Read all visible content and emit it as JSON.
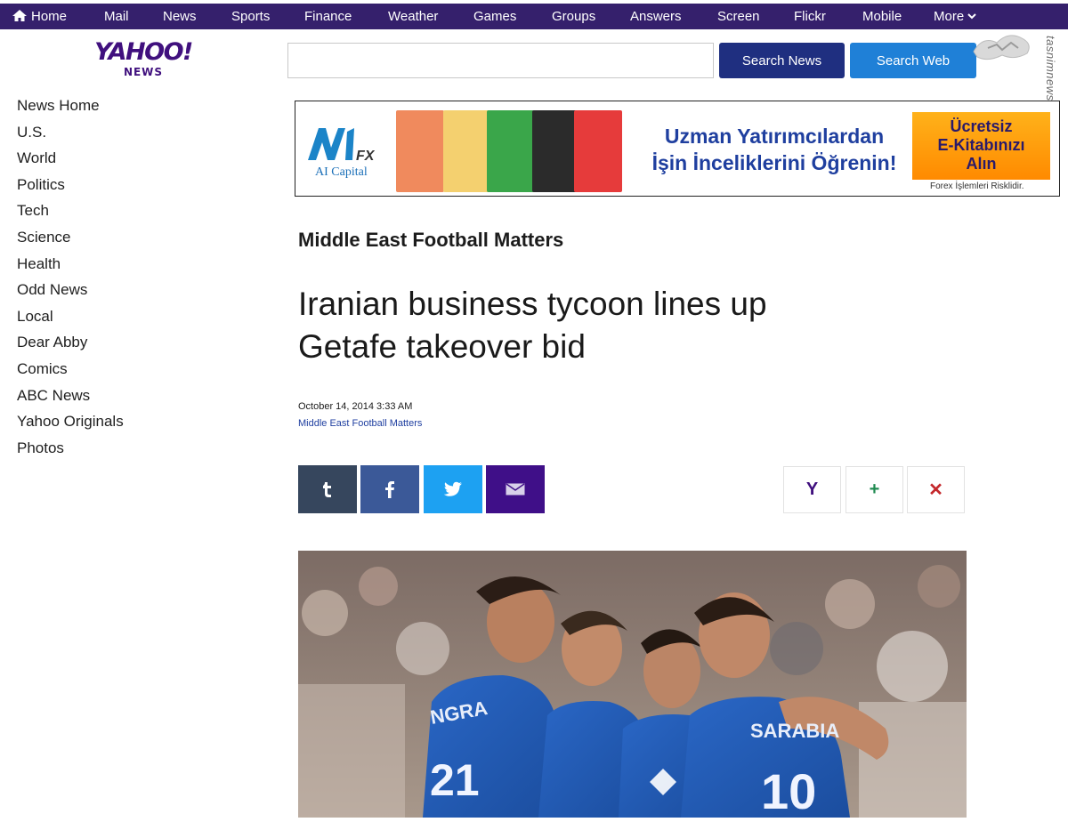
{
  "nav": {
    "items": [
      {
        "label": "Home",
        "icon": "home-icon"
      },
      {
        "label": "Mail"
      },
      {
        "label": "News"
      },
      {
        "label": "Sports"
      },
      {
        "label": "Finance"
      },
      {
        "label": "Weather"
      },
      {
        "label": "Games"
      },
      {
        "label": "Groups"
      },
      {
        "label": "Answers"
      },
      {
        "label": "Screen"
      },
      {
        "label": "Flickr"
      },
      {
        "label": "Mobile"
      },
      {
        "label": "More",
        "icon": "chevron-down-icon"
      }
    ],
    "bg_color": "#35206c"
  },
  "logo": {
    "brand": "YAHOO!",
    "sub": "NEWS",
    "color": "#40107e"
  },
  "search": {
    "value": "",
    "news_button": "Search News",
    "web_button": "Search Web"
  },
  "watermark": {
    "vertical_text": "tasnimnews.com"
  },
  "sidebar": {
    "items": [
      {
        "label": "News Home"
      },
      {
        "label": "U.S."
      },
      {
        "label": "World"
      },
      {
        "label": "Politics"
      },
      {
        "label": "Tech"
      },
      {
        "label": "Science"
      },
      {
        "label": "Health"
      },
      {
        "label": "Odd News"
      },
      {
        "label": "Local"
      },
      {
        "label": "Dear Abby"
      },
      {
        "label": "Comics"
      },
      {
        "label": "ABC News"
      },
      {
        "label": "Yahoo Originals"
      },
      {
        "label": "Photos"
      }
    ]
  },
  "ad": {
    "brand": "N1",
    "brand_suffix": "FX",
    "brand_sub": "AI Capital",
    "headline_1": "Uzman Yatırımcılardan",
    "headline_2": "İşin İnceliklerini Öğrenin!",
    "cta_1": "Ücretsiz",
    "cta_2": "E-Kitabınızı",
    "cta_3": "Alın",
    "disclaimer": "Forex İşlemleri Risklidir.",
    "book_colors": [
      "#f08a5d",
      "#f4d06f",
      "#3aa64a",
      "#2b2b2b",
      "#e63b3b"
    ]
  },
  "article": {
    "section": "Middle East Football Matters",
    "title_line1": "Iranian business tycoon lines up",
    "title_line2": "Getafe takeover bid",
    "date": "October 14, 2014 3:33 AM",
    "source": "Middle East Football Matters"
  },
  "share": {
    "buttons": [
      {
        "name": "tumblr",
        "icon": "tumblr-icon",
        "color": "#36465d"
      },
      {
        "name": "facebook",
        "icon": "facebook-icon",
        "color": "#3b5998"
      },
      {
        "name": "twitter",
        "icon": "twitter-icon",
        "color": "#1da1f2"
      },
      {
        "name": "email",
        "icon": "email-icon",
        "color": "#3f0f88"
      }
    ],
    "actions": [
      {
        "label": "Y",
        "color": "#40107e"
      },
      {
        "label": "+",
        "color": "#1f8a50"
      },
      {
        "label": "✕",
        "color": "#c4282c"
      }
    ]
  },
  "photo": {
    "jersey_1": "NGRA",
    "jersey_2": "SARABIA",
    "number_1": "21",
    "number_2": "10"
  }
}
